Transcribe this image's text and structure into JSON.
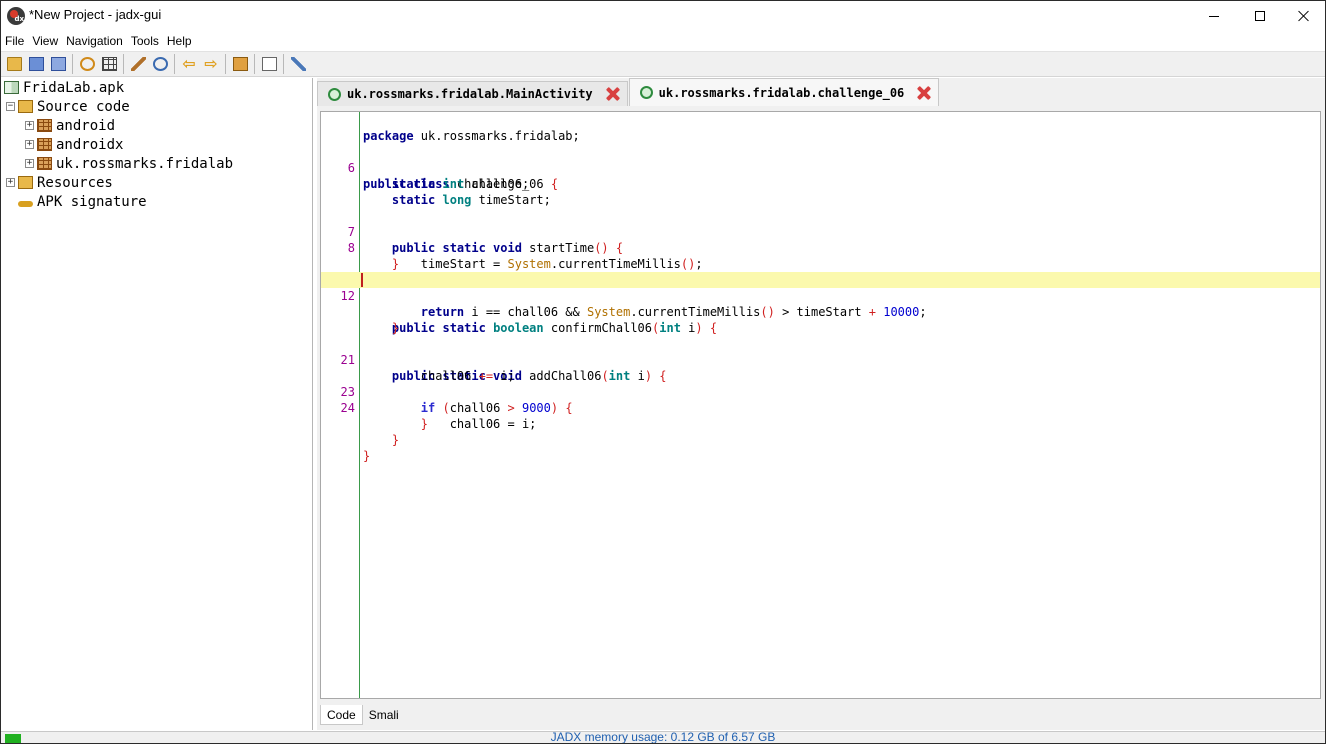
{
  "window": {
    "title": "*New Project - jadx-gui"
  },
  "menubar": [
    "File",
    "View",
    "Navigation",
    "Tools",
    "Help"
  ],
  "toolbar": {
    "icons": [
      "open-icon",
      "save-icon",
      "save-all-icon",
      "sync-icon",
      "full-screen-icon",
      "decompile-icon",
      "search-icon",
      "back-icon",
      "forward-icon",
      "clipboard-icon",
      "log-icon",
      "preferences-icon"
    ]
  },
  "tree": {
    "root": "FridaLab.apk",
    "source_code": "Source code",
    "packages": [
      "android",
      "androidx",
      "uk.rossmarks.fridalab"
    ],
    "resources": "Resources",
    "signature": "APK signature"
  },
  "tabs": [
    {
      "label": "uk.rossmarks.fridalab.MainActivity",
      "active": false
    },
    {
      "label": "uk.rossmarks.fridalab.challenge_06",
      "active": true
    }
  ],
  "code": {
    "line_numbers": [
      "6",
      "7",
      "8",
      "12",
      "21",
      "23",
      "24"
    ],
    "highlight_color": "#fbf9ad"
  },
  "bottom_tabs": [
    "Code",
    "Smali"
  ],
  "status": {
    "memory": "JADX memory usage: 0.12 GB of 6.57 GB"
  }
}
